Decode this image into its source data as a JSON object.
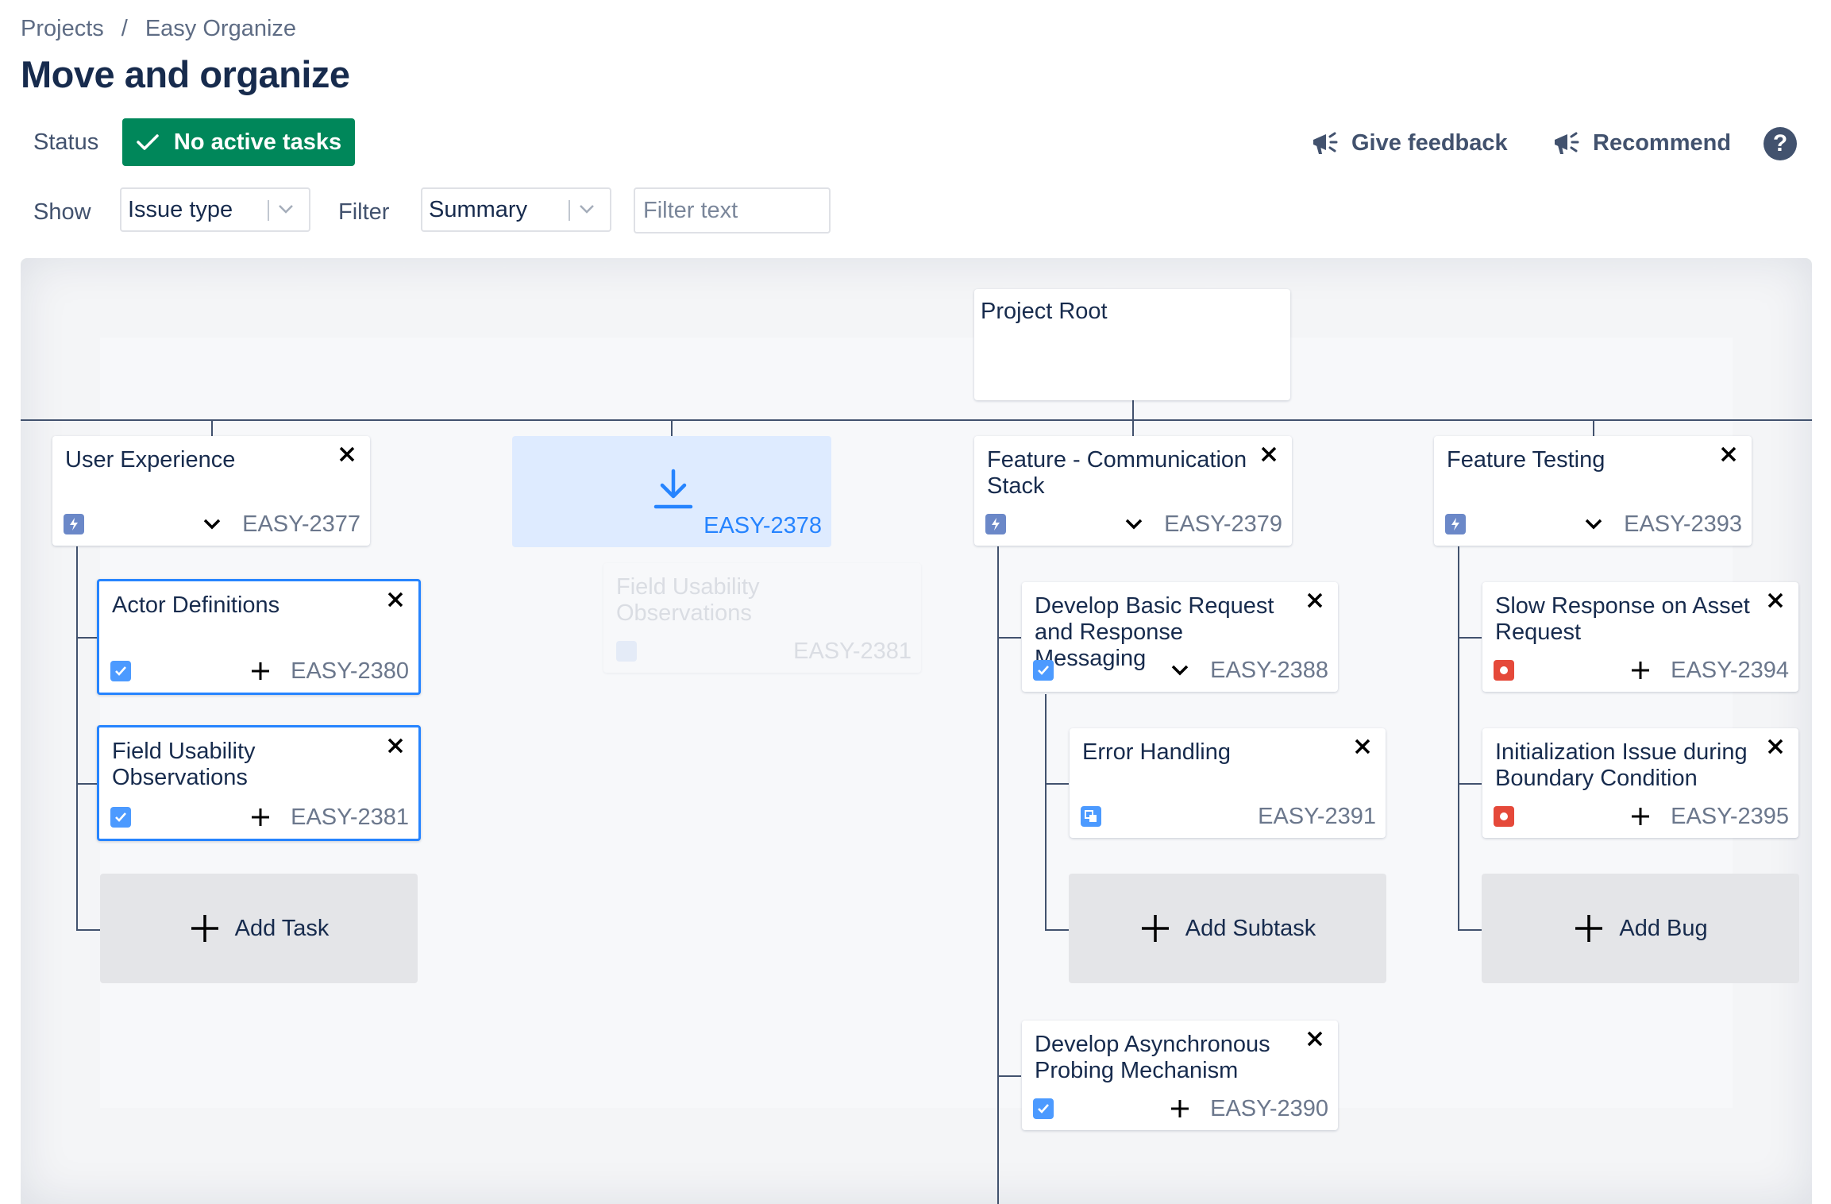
{
  "breadcrumb": {
    "projects": "Projects",
    "separator": "/",
    "project": "Easy Organize"
  },
  "page_title": "Move and organize",
  "status": {
    "label": "Status",
    "badge": "No active tasks"
  },
  "actions": {
    "feedback": "Give feedback",
    "recommend": "Recommend",
    "help": "?"
  },
  "toolbar": {
    "show_label": "Show",
    "show_value": "Issue type",
    "filter_label": "Filter",
    "filter_value": "Summary",
    "filter_placeholder": "Filter text"
  },
  "tree": {
    "root": {
      "title": "Project Root"
    },
    "epics": [
      {
        "title": "User Experience",
        "key": "EASY-2377"
      },
      {
        "key": "EASY-2378"
      },
      {
        "title": "Feature - Communication Stack",
        "key": "EASY-2379"
      },
      {
        "title": "Feature Testing",
        "key": "EASY-2393"
      }
    ],
    "ghost": {
      "title": "Field Usability Observations",
      "key": "EASY-2381"
    },
    "children": {
      "actor": {
        "title": "Actor Definitions",
        "key": "EASY-2380"
      },
      "field": {
        "title": "Field Usability Observations",
        "key": "EASY-2381"
      },
      "basic": {
        "title": "Develop Basic Request and Response Messaging",
        "key": "EASY-2388"
      },
      "error": {
        "title": "Error Handling",
        "key": "EASY-2391"
      },
      "async": {
        "title": "Develop Asynchronous Probing Mechanism",
        "key": "EASY-2390"
      },
      "slow": {
        "title": "Slow Response on Asset Request",
        "key": "EASY-2394"
      },
      "init": {
        "title": "Initialization Issue during Boundary Condition",
        "key": "EASY-2395"
      }
    },
    "add": {
      "task": "Add Task",
      "subtask": "Add Subtask",
      "bug": "Add Bug"
    }
  },
  "colors": {
    "accent": "#2684ff",
    "status": "#00875a",
    "bug": "#e5493a",
    "epic": "#6b88c8",
    "task": "#4c9aff"
  },
  "icons": [
    "check-icon",
    "megaphone-icon",
    "help-icon",
    "chevron-down-icon",
    "close-icon",
    "plus-icon",
    "download-arrow-icon",
    "epic-icon",
    "task-icon",
    "bug-icon",
    "subtask-icon"
  ]
}
